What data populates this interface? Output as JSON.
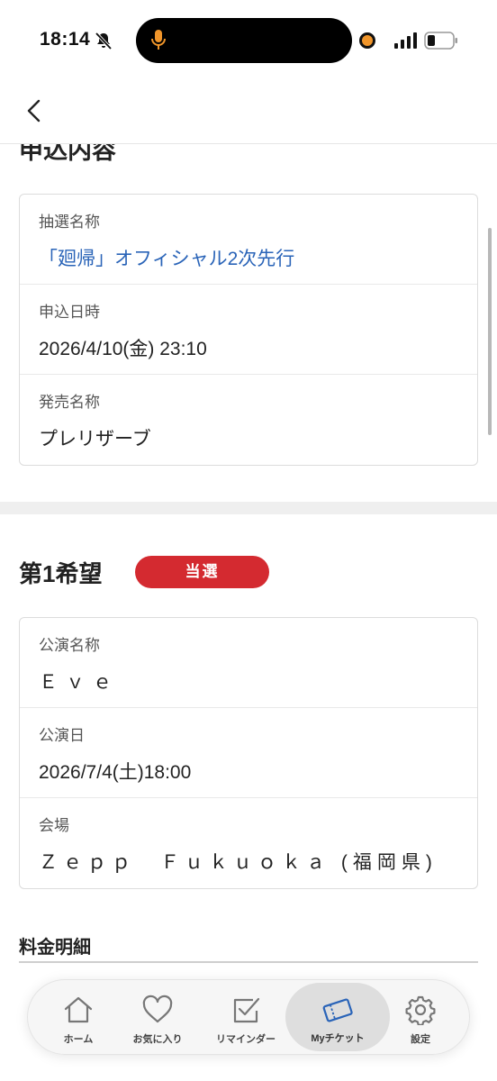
{
  "status_bar": {
    "time": "18:14",
    "icons": [
      "bell-slash-icon",
      "microphone-icon",
      "recording-dot-icon",
      "cellular-signal-icon",
      "battery-icon"
    ],
    "orange_accent": "#f0952a"
  },
  "header": {
    "back_icon": "chevron-left-icon"
  },
  "application_section": {
    "title": "申込内容",
    "rows": [
      {
        "label": "抽選名称",
        "value": "「廻帰」オフィシャル2次先行"
      },
      {
        "label": "申込日時",
        "value": "2026/4/10(金) 23:10"
      },
      {
        "label": "発売名称",
        "value": "プレリザーブ"
      }
    ]
  },
  "first_choice": {
    "title": "第1希望",
    "status": "当選",
    "status_color": "#d42a30",
    "rows": [
      {
        "label": "公演名称",
        "value": "Ｅｖｅ"
      },
      {
        "label": "公演日",
        "value": "2026/7/4(土)18:00"
      },
      {
        "label": "会場",
        "value": "Ｚｅｐｐ　Ｆｕｋｕｏｋａ (福岡県)"
      }
    ]
  },
  "fee_section": {
    "title": "料金明細"
  },
  "link_color": "#2a64b8",
  "tab_bar": {
    "active": "Myチケット",
    "tabs": [
      {
        "label": "ホーム",
        "icon": "home-icon"
      },
      {
        "label": "お気に入り",
        "icon": "heart-icon"
      },
      {
        "label": "リマインダー",
        "icon": "checkbox-icon"
      },
      {
        "label": "Myチケット",
        "icon": "ticket-icon"
      },
      {
        "label": "設定",
        "icon": "gear-icon"
      }
    ]
  }
}
